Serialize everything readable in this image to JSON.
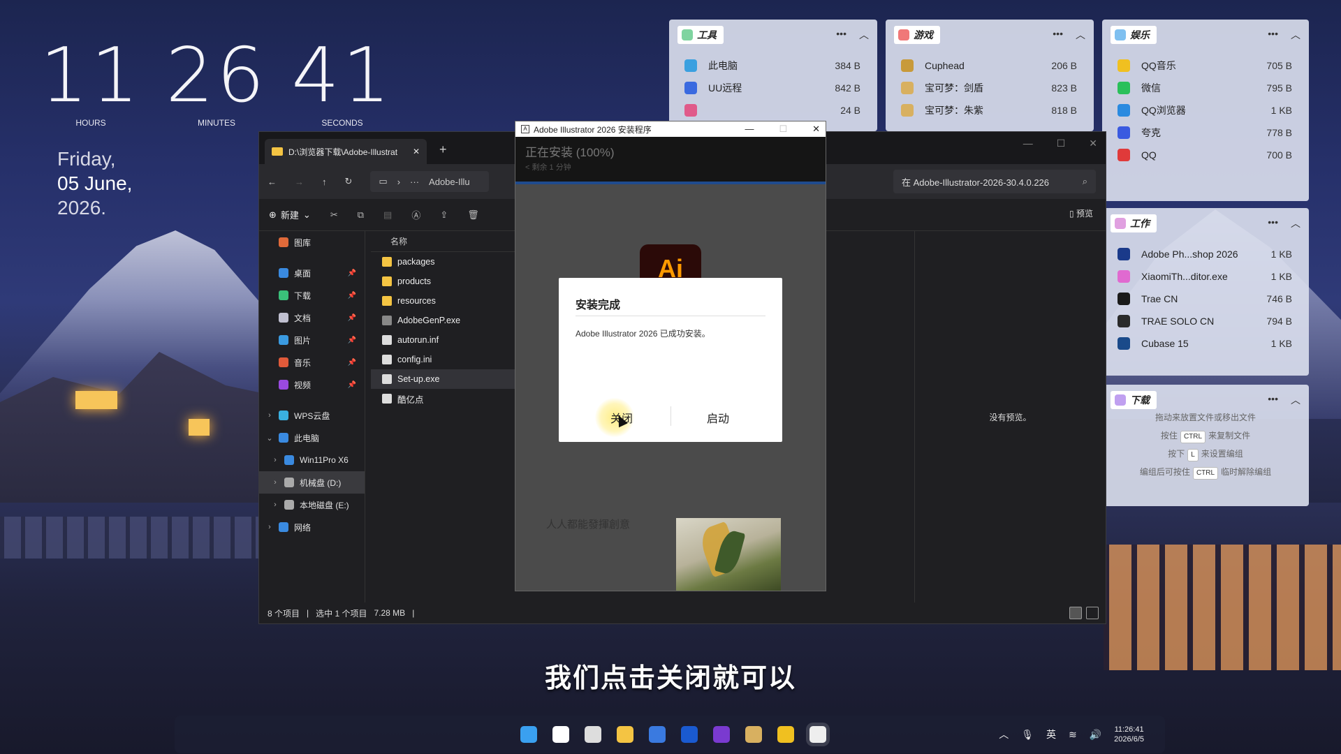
{
  "clock": {
    "hours": "11",
    "minutes": "26",
    "seconds": "41",
    "hours_label": "HOURS",
    "minutes_label": "MINUTES",
    "seconds_label": "SECONDS"
  },
  "date": {
    "weekday": "Friday,",
    "day_month": "05 June,",
    "year": "2026."
  },
  "widgets": {
    "tools": {
      "title": "工具",
      "color": "#7fd4a0",
      "items": [
        {
          "name": "此电脑",
          "size": "384 B",
          "icon": "monitor-icon",
          "color": "#3aa0e0"
        },
        {
          "name": "UU远程",
          "size": "842 B",
          "icon": "uu-remote-icon",
          "color": "#3a6ae0"
        },
        {
          "name": "",
          "size": "24 B",
          "icon": "app-icon",
          "color": "#e05a8a"
        }
      ]
    },
    "games": {
      "title": "游戏",
      "color": "#f07878",
      "items": [
        {
          "name": "Cuphead",
          "size": "206 B",
          "icon": "cuphead-icon",
          "color": "#c89a3a"
        },
        {
          "name": "宝可梦：剑盾",
          "size": "823 B",
          "icon": "pokemon-icon",
          "color": "#d8b060"
        },
        {
          "name": "宝可梦：朱紫",
          "size": "818 B",
          "icon": "pokemon-icon",
          "color": "#d8b060"
        }
      ]
    },
    "entertainment": {
      "title": "娱乐",
      "color": "#7fc0f0",
      "items": [
        {
          "name": "QQ音乐",
          "size": "705 B",
          "icon": "qq-music-icon",
          "color": "#f0c020"
        },
        {
          "name": "微信",
          "size": "795 B",
          "icon": "wechat-icon",
          "color": "#2ac05a"
        },
        {
          "name": "QQ浏览器",
          "size": "1 KB",
          "icon": "qq-browser-icon",
          "color": "#2a8ae0"
        },
        {
          "name": "夸克",
          "size": "778 B",
          "icon": "quark-icon",
          "color": "#3a5ae0"
        },
        {
          "name": "QQ",
          "size": "700 B",
          "icon": "qq-icon",
          "color": "#e03a3a"
        }
      ]
    },
    "work": {
      "title": "工作",
      "color": "#e0a0e0",
      "items": [
        {
          "name": "Adobe Ph...shop 2026",
          "size": "1 KB",
          "icon": "photoshop-icon",
          "color": "#1a3a8a"
        },
        {
          "name": "XiaomiTh...ditor.exe",
          "size": "1 KB",
          "icon": "xiaomi-icon",
          "color": "#e06ad0"
        },
        {
          "name": "Trae CN",
          "size": "746 B",
          "icon": "trae-icon",
          "color": "#1a1a1a"
        },
        {
          "name": "TRAE SOLO CN",
          "size": "794 B",
          "icon": "trae-solo-icon",
          "color": "#2a2a2a"
        },
        {
          "name": "Cubase 15",
          "size": "1 KB",
          "icon": "cubase-icon",
          "color": "#1a4a8a"
        }
      ]
    },
    "downloads": {
      "title": "下载",
      "color": "#c0a0f0",
      "hint1": "拖动来放置文件或移出文件",
      "hint2_pre": "按住",
      "hint2_key": "CTRL",
      "hint2_post": "来复制文件",
      "hint3_pre": "按下",
      "hint3_key": "L",
      "hint3_post": "来设置编组",
      "hint4_pre": "编组后可按住",
      "hint4_key": "CTRL",
      "hint4_post": "临时解除编组"
    }
  },
  "explorer": {
    "tab_title": "D:\\浏览器下载\\Adobe-Illustrat",
    "address": "Adobe-Illu",
    "search_placeholder": "在 Adobe-Illustrator-2026-30.4.0.226",
    "new_label": "新建",
    "preview_label": "预览",
    "column_name": "名称",
    "sidebar": [
      {
        "label": "图库",
        "icon": "gallery-icon",
        "color": "#e06a3a",
        "pin": false,
        "chev": ""
      },
      {
        "label": "桌面",
        "icon": "desktop-icon",
        "color": "#3a8ae0",
        "pin": true,
        "chev": ""
      },
      {
        "label": "下载",
        "icon": "download-icon",
        "color": "#3ac07a",
        "pin": true,
        "chev": ""
      },
      {
        "label": "文档",
        "icon": "document-icon",
        "color": "#c0c0d0",
        "pin": true,
        "chev": ""
      },
      {
        "label": "图片",
        "icon": "pictures-icon",
        "color": "#3a9ae0",
        "pin": true,
        "chev": ""
      },
      {
        "label": "音乐",
        "icon": "music-icon",
        "color": "#e05a3a",
        "pin": true,
        "chev": ""
      },
      {
        "label": "视频",
        "icon": "video-icon",
        "color": "#9a4ae0",
        "pin": true,
        "chev": ""
      },
      {
        "label": "WPS云盘",
        "icon": "cloud-icon",
        "color": "#3ab0e0",
        "pin": false,
        "chev": "›"
      },
      {
        "label": "此电脑",
        "icon": "monitor-icon",
        "color": "#3a8ae0",
        "pin": false,
        "chev": "⌄"
      },
      {
        "label": "Win11Pro X6",
        "icon": "drive-icon",
        "color": "#3a8ae0",
        "pin": false,
        "chev": "›"
      },
      {
        "label": "机械盘 (D:)",
        "icon": "drive-icon",
        "color": "#aaaaaa",
        "pin": false,
        "chev": "›"
      },
      {
        "label": "本地磁盘 (E:)",
        "icon": "drive-icon",
        "color": "#aaaaaa",
        "pin": false,
        "chev": "›"
      },
      {
        "label": "网络",
        "icon": "network-icon",
        "color": "#3a8ae0",
        "pin": false,
        "chev": "›"
      }
    ],
    "files": [
      {
        "name": "packages",
        "icon": "folder-icon",
        "color": "#f4c443"
      },
      {
        "name": "products",
        "icon": "folder-icon",
        "color": "#f4c443"
      },
      {
        "name": "resources",
        "icon": "folder-icon",
        "color": "#f4c443"
      },
      {
        "name": "AdobeGenP.exe",
        "icon": "exe-icon",
        "color": "#888888"
      },
      {
        "name": "autorun.inf",
        "icon": "file-icon",
        "color": "#dddddd"
      },
      {
        "name": "config.ini",
        "icon": "file-icon",
        "color": "#dddddd"
      },
      {
        "name": "Set-up.exe",
        "icon": "setup-icon",
        "color": "#dddddd"
      },
      {
        "name": "酷亿点",
        "icon": "file-icon",
        "color": "#dddddd"
      }
    ],
    "no_preview": "没有预览。",
    "status_count": "8 个项目",
    "status_selected": "选中 1 个项目",
    "status_size": "7.28 MB"
  },
  "installer": {
    "title": "Adobe Illustrator 2026 安装程序",
    "status": "正在安装 (100%)",
    "remaining": "< 剩余 1 分钟",
    "progress": 1.0,
    "logo_text": "Ai",
    "tagline": "人人都能發揮創意"
  },
  "dialog": {
    "title": "安装完成",
    "message": "Adobe Illustrator 2026 已成功安装。",
    "close_label": "关闭",
    "launch_label": "启动"
  },
  "subtitle": "我们点击关闭就可以",
  "taskbar": {
    "apps": [
      {
        "icon": "windows-start-icon",
        "color": "#3aa0f0"
      },
      {
        "icon": "search-icon",
        "color": "#ffffff"
      },
      {
        "icon": "task-view-icon",
        "color": "#dddddd"
      },
      {
        "icon": "file-explorer-icon",
        "color": "#f4c443"
      },
      {
        "icon": "browser-icon",
        "color": "#3a7ae0"
      },
      {
        "icon": "p-app-icon",
        "color": "#1a5ad0"
      },
      {
        "icon": "obsidian-icon",
        "color": "#7a3ad0"
      },
      {
        "icon": "pokemon-icon",
        "color": "#d8b060"
      },
      {
        "icon": "qq-music-icon",
        "color": "#f0c020"
      },
      {
        "icon": "adobe-installer-icon",
        "color": "#eeeeee"
      }
    ],
    "ime": "英",
    "time": "11:26:41",
    "date": "2026/6/5"
  }
}
